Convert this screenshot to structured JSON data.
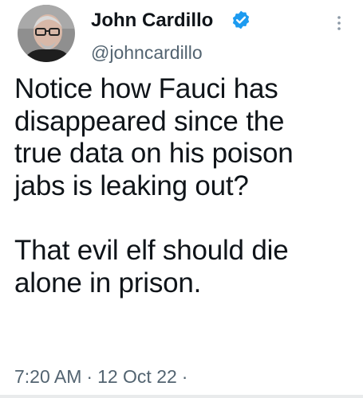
{
  "author": {
    "display_name": "John Cardillo",
    "handle": "@johncardillo",
    "verified_icon": "verified-badge-icon",
    "avatar_icon": "avatar"
  },
  "tweet": {
    "lines_para1": [
      "Notice how Fauci has",
      "disappeared since the",
      "true data on his poison",
      "jabs is leaking out?"
    ],
    "lines_para2": [
      "That evil elf should die",
      "alone in prison."
    ]
  },
  "meta": {
    "time": "7:20 AM",
    "date": "12 Oct 22",
    "separator": "·",
    "trailing": "·"
  },
  "more_icon": "more-options-icon",
  "colors": {
    "text": "#0f1419",
    "secondary": "#536471",
    "verified": "#1d9bf0"
  }
}
